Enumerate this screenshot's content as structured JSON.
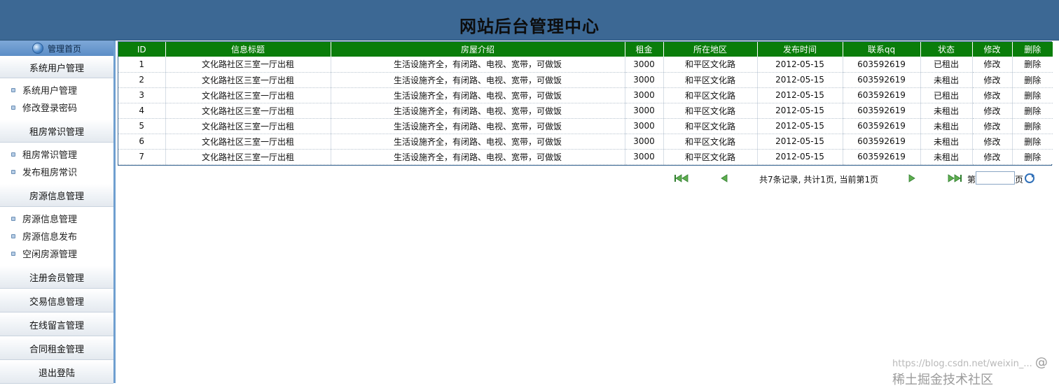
{
  "header": {
    "title": "网站后台管理中心"
  },
  "sidebar": {
    "home": "管理首页",
    "groups": [
      {
        "label": "系统用户管理",
        "items": [
          "系统用户管理",
          "修改登录密码"
        ]
      },
      {
        "label": "租房常识管理",
        "items": [
          "租房常识管理",
          "发布租房常识"
        ]
      },
      {
        "label": "房源信息管理",
        "items": [
          "房源信息管理",
          "房源信息发布",
          "空闲房源管理"
        ]
      },
      {
        "label": "注册会员管理",
        "items": []
      },
      {
        "label": "交易信息管理",
        "items": []
      },
      {
        "label": "在线留言管理",
        "items": []
      },
      {
        "label": "合同租金管理",
        "items": []
      },
      {
        "label": "退出登陆",
        "items": []
      }
    ]
  },
  "table": {
    "columns": [
      "ID",
      "信息标题",
      "房屋介绍",
      "租金",
      "所在地区",
      "发布时间",
      "联系qq",
      "状态",
      "修改",
      "删除"
    ],
    "rows": [
      [
        "1",
        "文化路社区三室一厅出租",
        "生活设施齐全，有闭路、电视、宽带，可做饭",
        "3000",
        "和平区文化路",
        "2012-05-15",
        "603592619",
        "已租出",
        "修改",
        "删除"
      ],
      [
        "2",
        "文化路社区三室一厅出租",
        "生活设施齐全，有闭路、电视、宽带，可做饭",
        "3000",
        "和平区文化路",
        "2012-05-15",
        "603592619",
        "未租出",
        "修改",
        "删除"
      ],
      [
        "3",
        "文化路社区三室一厅出租",
        "生活设施齐全，有闭路、电视、宽带，可做饭",
        "3000",
        "和平区文化路",
        "2012-05-15",
        "603592619",
        "已租出",
        "修改",
        "删除"
      ],
      [
        "4",
        "文化路社区三室一厅出租",
        "生活设施齐全，有闭路、电视、宽带，可做饭",
        "3000",
        "和平区文化路",
        "2012-05-15",
        "603592619",
        "未租出",
        "修改",
        "删除"
      ],
      [
        "5",
        "文化路社区三室一厅出租",
        "生活设施齐全，有闭路、电视、宽带，可做饭",
        "3000",
        "和平区文化路",
        "2012-05-15",
        "603592619",
        "未租出",
        "修改",
        "删除"
      ],
      [
        "6",
        "文化路社区三室一厅出租",
        "生活设施齐全，有闭路、电视、宽带，可做饭",
        "3000",
        "和平区文化路",
        "2012-05-15",
        "603592619",
        "未租出",
        "修改",
        "删除"
      ],
      [
        "7",
        "文化路社区三室一厅出租",
        "生活设施齐全，有闭路、电视、宽带，可做饭",
        "3000",
        "和平区文化路",
        "2012-05-15",
        "603592619",
        "未租出",
        "修改",
        "删除"
      ]
    ]
  },
  "pager": {
    "info": "共7条记录, 共计1页, 当前第1页",
    "jump_prefix": "第",
    "jump_suffix": "页",
    "jump_value": ""
  },
  "watermark": {
    "url": "https://blog.csdn.net/weixin_...",
    "brand": "@稀土掘金技术社区"
  },
  "colors": {
    "header_bg": "#3c6894",
    "table_header_bg": "#0a7d0a",
    "sidebar_accent": "#6f9fd0"
  }
}
